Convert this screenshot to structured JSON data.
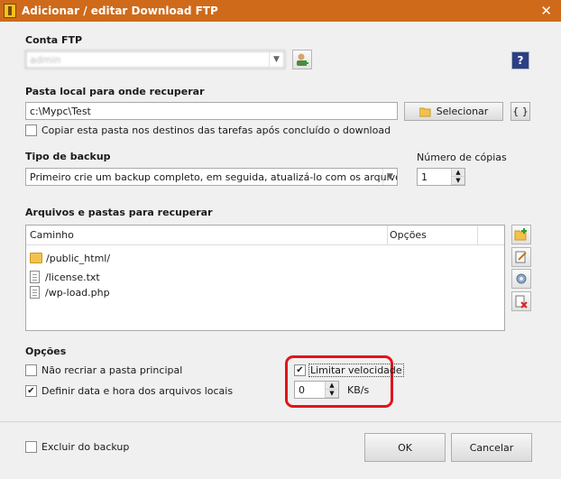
{
  "window": {
    "title": "Adicionar / editar Download FTP",
    "close_glyph": "✕"
  },
  "ftp_account": {
    "label": "Conta FTP",
    "value": "admin"
  },
  "local_folder": {
    "label": "Pasta local para onde recuperar",
    "value": "c:\\Mypc\\Test",
    "select_button": "Selecionar",
    "vars_button": "{ }",
    "copy_checkbox_label": "Copiar esta pasta nos destinos das tarefas após concluído o download",
    "copy_checked": false
  },
  "backup_type": {
    "label": "Tipo de backup",
    "value": "Primeiro crie um backup completo, em seguida, atualizá-lo com os arquivos novos e",
    "copies_label": "Número de cópias",
    "copies_value": "1"
  },
  "files": {
    "label": "Arquivos e pastas para recuperar",
    "columns": [
      "Caminho",
      "Opções"
    ],
    "items": [
      {
        "path": "/public_html/",
        "type": "folder"
      },
      {
        "path": "/license.txt",
        "type": "file"
      },
      {
        "path": "/wp-load.php",
        "type": "file"
      }
    ]
  },
  "options": {
    "label": "Opções",
    "no_recreate_label": "Não recriar a pasta principal",
    "no_recreate_checked": false,
    "set_datetime_label": "Definir data e hora dos arquivos locais",
    "set_datetime_checked": true,
    "limit_speed_label": "Limitar velocidade",
    "limit_speed_checked": true,
    "speed_value": "0",
    "speed_unit": "KB/s"
  },
  "footer": {
    "exclude_label": "Excluir do backup",
    "exclude_checked": false,
    "ok": "OK",
    "cancel": "Cancelar"
  },
  "colors": {
    "titlebar": "#cf6a1b",
    "highlight": "#e2141c"
  },
  "check_glyph": "✔"
}
